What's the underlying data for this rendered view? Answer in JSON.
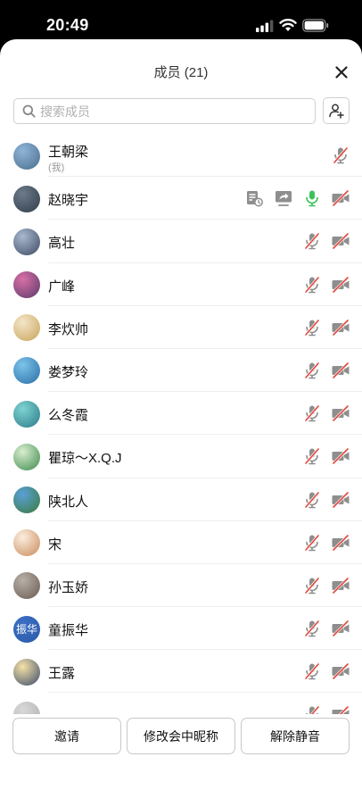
{
  "status_bar": {
    "time": "20:49"
  },
  "sheet": {
    "title": "成员 (21)",
    "close_icon": "close-icon",
    "search_placeholder": "搜索成员",
    "add_member_icon": "add-member-icon"
  },
  "members": [
    {
      "name": "王朝梁",
      "sub": "(我)",
      "avatar_colors": [
        "#8fb4d8",
        "#4a6e8c"
      ],
      "extra_icons": [],
      "mic": "muted",
      "camera": "none"
    },
    {
      "name": "赵晓宇",
      "avatar_colors": [
        "#6c7a8a",
        "#2f3d4a"
      ],
      "extra_icons": [
        "document-icon",
        "screen-share-icon"
      ],
      "mic": "active",
      "camera": "off"
    },
    {
      "name": "高壮",
      "avatar_colors": [
        "#a9b8cf",
        "#3c4a63"
      ],
      "extra_icons": [],
      "mic": "muted",
      "camera": "off"
    },
    {
      "name": "广峰",
      "avatar_colors": [
        "#d86fa6",
        "#5a3a6a"
      ],
      "extra_icons": [],
      "mic": "muted",
      "camera": "off"
    },
    {
      "name": "李炊帅",
      "avatar_colors": [
        "#f3e6c8",
        "#c9a35a"
      ],
      "extra_icons": [],
      "mic": "muted",
      "camera": "off"
    },
    {
      "name": "娄梦玲",
      "avatar_colors": [
        "#7cc3ea",
        "#2a6ea6"
      ],
      "extra_icons": [],
      "mic": "muted",
      "camera": "off"
    },
    {
      "name": "么冬霞",
      "avatar_colors": [
        "#7fd3d0",
        "#2a7a8a"
      ],
      "extra_icons": [],
      "mic": "muted",
      "camera": "off"
    },
    {
      "name": "瞿琼～X.Q.J",
      "avatar_colors": [
        "#d8eed0",
        "#3c8a4a"
      ],
      "extra_icons": [],
      "mic": "muted",
      "camera": "off"
    },
    {
      "name": "陕北人",
      "avatar_colors": [
        "#5aa0d8",
        "#3a7a3a"
      ],
      "extra_icons": [],
      "mic": "muted",
      "camera": "off"
    },
    {
      "name": "宋",
      "avatar_colors": [
        "#fbeee0",
        "#c98a5a"
      ],
      "extra_icons": [],
      "mic": "muted",
      "camera": "off"
    },
    {
      "name": "孙玉娇",
      "avatar_colors": [
        "#b8b0a8",
        "#6a5a50"
      ],
      "extra_icons": [],
      "mic": "muted",
      "camera": "off"
    },
    {
      "name": "童振华",
      "avatar_text": "振华",
      "avatar_colors": [
        "#3b6fc4",
        "#2c5aa8"
      ],
      "extra_icons": [],
      "mic": "muted",
      "camera": "off"
    },
    {
      "name": "王露",
      "avatar_colors": [
        "#f6e2a8",
        "#3a4a6a"
      ],
      "extra_icons": [],
      "mic": "muted",
      "camera": "off"
    },
    {
      "name": "",
      "avatar_colors": [
        "#d8d8d8",
        "#b0b0b0"
      ],
      "extra_icons": [],
      "mic": "muted",
      "camera": "off"
    }
  ],
  "buttons": {
    "invite": "邀请",
    "rename": "修改会中昵称",
    "unmute": "解除静音"
  },
  "colors": {
    "muted_slash": "#e0463c",
    "icon_gray": "#8e8e8e",
    "mic_active": "#3ac35a"
  }
}
